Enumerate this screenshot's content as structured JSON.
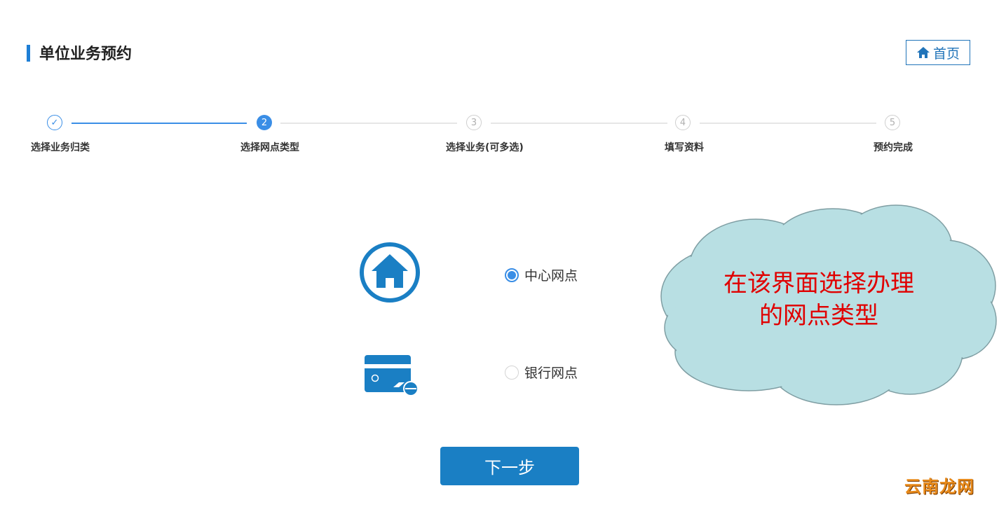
{
  "header": {
    "title": "单位业务预约",
    "home_label": "首页"
  },
  "steps": [
    {
      "number": "✓",
      "label": "选择业务归类",
      "state": "done"
    },
    {
      "number": "2",
      "label": "选择网点类型",
      "state": "active"
    },
    {
      "number": "3",
      "label": "选择业务(可多选)",
      "state": "todo"
    },
    {
      "number": "4",
      "label": "填写资料",
      "state": "todo"
    },
    {
      "number": "5",
      "label": "预约完成",
      "state": "todo"
    }
  ],
  "options": [
    {
      "label": "中心网点",
      "selected": true,
      "icon": "home-circle-icon"
    },
    {
      "label": "银行网点",
      "selected": false,
      "icon": "bank-card-icon"
    }
  ],
  "next_label": "下一步",
  "callout": {
    "line1": "在该界面选择办理",
    "line2": "的网点类型"
  },
  "watermark": "云南龙网",
  "colors": {
    "accent": "#3a8ee6",
    "button": "#1a7fc4",
    "callout_fill": "#b8dfe3",
    "callout_text": "#e00000"
  }
}
